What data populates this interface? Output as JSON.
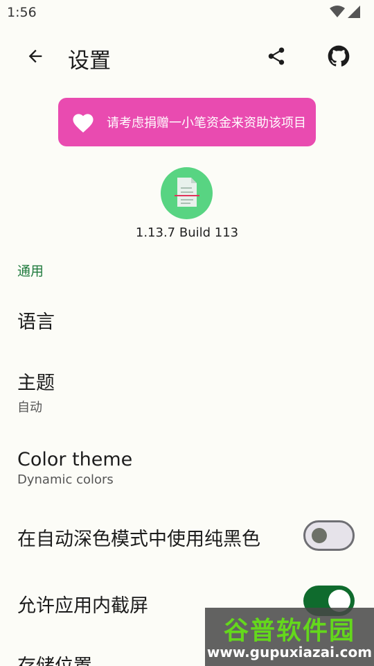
{
  "status_bar": {
    "time": "1:56",
    "icons": [
      "wifi-icon",
      "signal-icon"
    ]
  },
  "app_bar": {
    "title": "设置",
    "icons": [
      "arrow-back-icon",
      "share-icon",
      "github-icon"
    ]
  },
  "donate": {
    "label": "请考虑捐赠一小笔资金来资助该项目",
    "icon": "heart-icon",
    "background": "#e94bb0"
  },
  "about": {
    "version": "1.13.7 Build 113",
    "logo_icon": "document-scan-icon",
    "logo_color": "#58d482"
  },
  "general": {
    "header": "通用",
    "header_color": "#1f7a3d",
    "items": [
      {
        "title": "语言"
      },
      {
        "title": "主题",
        "subtitle": "自动"
      },
      {
        "title": "Color theme",
        "subtitle": "Dynamic colors"
      },
      {
        "title": "在自动深色模式中使用纯黑色",
        "toggle": false
      },
      {
        "title": "允许应用内截屏",
        "toggle": true
      },
      {
        "title": "存储位置"
      }
    ]
  },
  "watermark": {
    "brand": "谷普软件园",
    "url": "www.gupuxiazai.com"
  }
}
